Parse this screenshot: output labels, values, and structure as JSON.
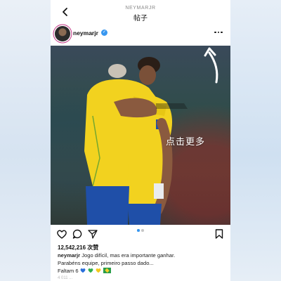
{
  "topbar": {
    "username": "NEYMARJR",
    "title": "帖子"
  },
  "post": {
    "author": "neymarjr",
    "overlay_label": "点击更多",
    "likes": "12,542,216 次赞",
    "caption_author": "neymarjr",
    "caption_line1": "Jogo difícil, mas era importante ganhar.",
    "caption_line2": "Parabéns equipe, primeiro passo dado...",
    "caption_line3": "Faltam 6",
    "faded_footer": "4 011 ..."
  },
  "icons": {
    "back": "chevron-left-icon",
    "more": "more-horizontal-icon",
    "verified": "verified-badge-icon",
    "like": "heart-icon",
    "comment": "comment-icon",
    "share": "send-icon",
    "save": "bookmark-icon",
    "arrow": "curved-arrow-icon"
  },
  "colors": {
    "verified_blue": "#3897f0",
    "carousel_active": "#3897f0",
    "carousel_inactive": "#c7c7c7",
    "jersey_yellow": "#f2d21f",
    "shorts_blue": "#1f4fa8"
  },
  "carousel": {
    "count": 2,
    "active_index": 0
  }
}
